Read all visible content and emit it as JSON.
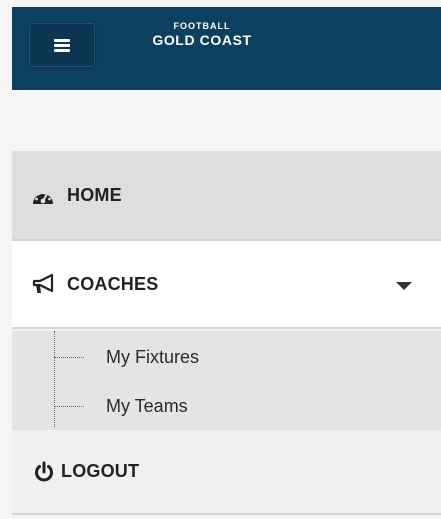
{
  "header": {
    "brand_line1": "FOOTBALL",
    "brand_line2": "GOLD COAST",
    "menu_icon": "hamburger-icon",
    "bg_color": "#0d3f5f"
  },
  "nav": {
    "home": {
      "label": "HOME",
      "icon": "dashboard-icon"
    },
    "coaches": {
      "label": "COACHES",
      "icon": "bullhorn-icon",
      "expanded": true,
      "children": [
        {
          "label": "My Fixtures"
        },
        {
          "label": "My Teams"
        }
      ]
    },
    "logout": {
      "label": "LOGOUT",
      "icon": "power-icon"
    }
  }
}
